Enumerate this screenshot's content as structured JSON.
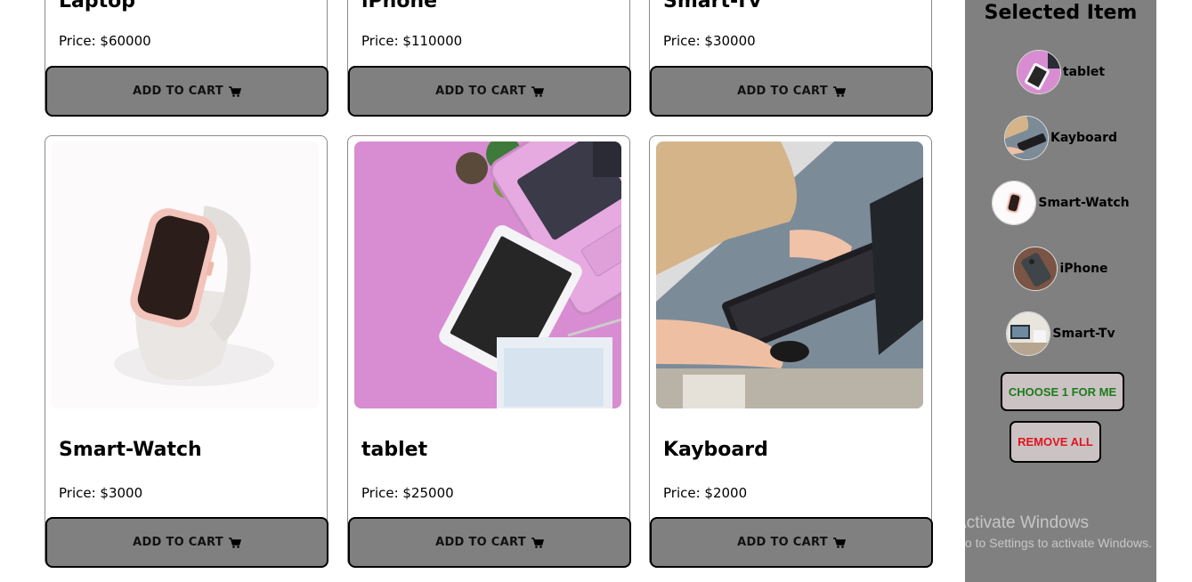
{
  "top_row": [
    {
      "title": "Laptop",
      "price": "Price: $60000",
      "button": "ADD TO CART"
    },
    {
      "title": "iPhone",
      "price": "Price: $110000",
      "button": "ADD TO CART"
    },
    {
      "title": "Smart-Tv",
      "price": "Price: $30000",
      "button": "ADD TO CART"
    }
  ],
  "bottom_row": [
    {
      "title": "Smart-Watch",
      "price": "Price: $3000",
      "button": "ADD TO CART"
    },
    {
      "title": "tablet",
      "price": "Price: $25000",
      "button": "ADD TO CART"
    },
    {
      "title": "Kayboard",
      "price": "Price: $2000",
      "button": "ADD TO CART"
    }
  ],
  "sidebar": {
    "title": "Selected Item",
    "items": [
      {
        "label": "tablet"
      },
      {
        "label": "Kayboard"
      },
      {
        "label": "Smart-Watch"
      },
      {
        "label": "iPhone"
      },
      {
        "label": "Smart-Tv"
      }
    ],
    "choose_label": "CHOOSE 1 FOR ME",
    "remove_label": "REMOVE ALL"
  },
  "watermark": {
    "line1": "Activate Windows",
    "line2": "Go to Settings to activate Windows."
  },
  "colors": {
    "sidebar_bg": "#808080",
    "button_bg": "#808080",
    "choose_text": "#1c7b1c",
    "remove_text": "#e0141f"
  }
}
